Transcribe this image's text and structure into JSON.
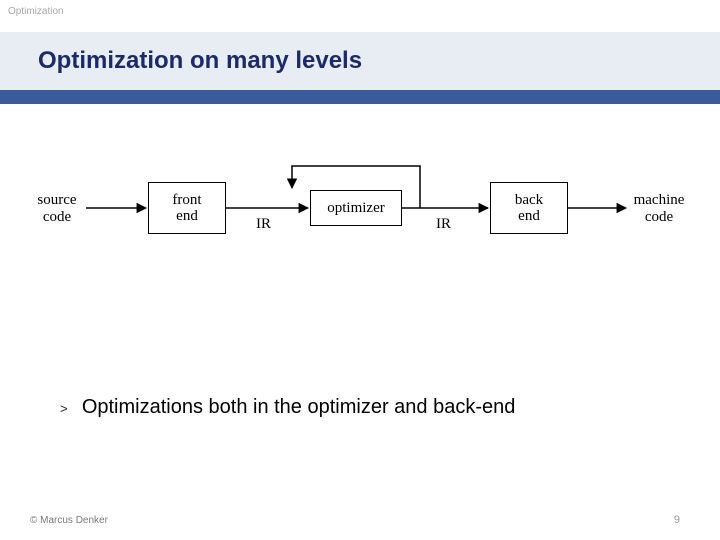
{
  "header": {
    "section": "Optimization",
    "title": "Optimization on many levels"
  },
  "diagram": {
    "source": {
      "l1": "source",
      "l2": "code"
    },
    "frontend": {
      "l1": "front",
      "l2": "end"
    },
    "ir1": "IR",
    "optimizer": "optimizer",
    "ir2": "IR",
    "backend": {
      "l1": "back",
      "l2": "end"
    },
    "machine": {
      "l1": "machine",
      "l2": "code"
    }
  },
  "bullets": {
    "marker": ">",
    "b1": "Optimizations both in the optimizer and back-end"
  },
  "footer": {
    "copyright": "© Marcus Denker",
    "page": "9"
  }
}
